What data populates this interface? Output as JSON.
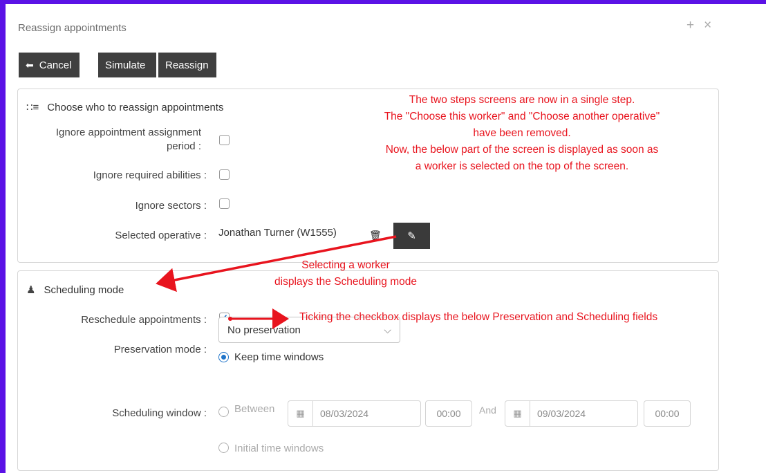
{
  "window": {
    "title": "Reassign appointments",
    "controls": [
      "+",
      "×"
    ]
  },
  "toolbar": {
    "cancel_label": "Cancel",
    "simulate_label": "Simulate",
    "reassign_label": "Reassign"
  },
  "section1": {
    "title": "Choose who to reassign appointments",
    "ignore_assignment_period_label_line1": "Ignore appointment assignment",
    "ignore_assignment_period_label_line2": "period :",
    "ignore_required_abilities_label": "Ignore required abilities :",
    "ignore_sectors_label": "Ignore sectors :",
    "selected_operative_label": "Selected operative :",
    "selected_operative_value": "Jonathan Turner (W1555)"
  },
  "section2": {
    "title": "Scheduling mode",
    "reschedule_label": "Reschedule appointments :",
    "reschedule_checked": true,
    "preservation_label": "Preservation mode :",
    "preservation_value": "No preservation",
    "keep_time_windows": "Keep time windows",
    "scheduling_window_label": "Scheduling window :",
    "between_label": "Between",
    "date_from": "08/03/2024",
    "time_from": "00:00",
    "and_label": "And",
    "date_to": "09/03/2024",
    "time_to": "00:00",
    "initial_time_windows": "Initial time windows"
  },
  "annotations": {
    "note1_line1": "The two steps screens are now in a single step.",
    "note1_line2": "The \"Choose this worker\" and \"Choose another operative\"",
    "note1_line3": "have been removed.",
    "note1_line4": "Now, the below part of the screen is displayed as soon as",
    "note1_line5": "a worker is selected on the top of the screen.",
    "note2_line1": "Selecting a worker",
    "note2_line2": "displays the Scheduling mode",
    "note3": "Ticking the checkbox displays the below Preservation and Scheduling fields",
    "color": "#e8141e"
  },
  "colors": {
    "frame": "#5b12e6",
    "button_bg": "#3f3f3f",
    "accent": "#1f74c9"
  }
}
